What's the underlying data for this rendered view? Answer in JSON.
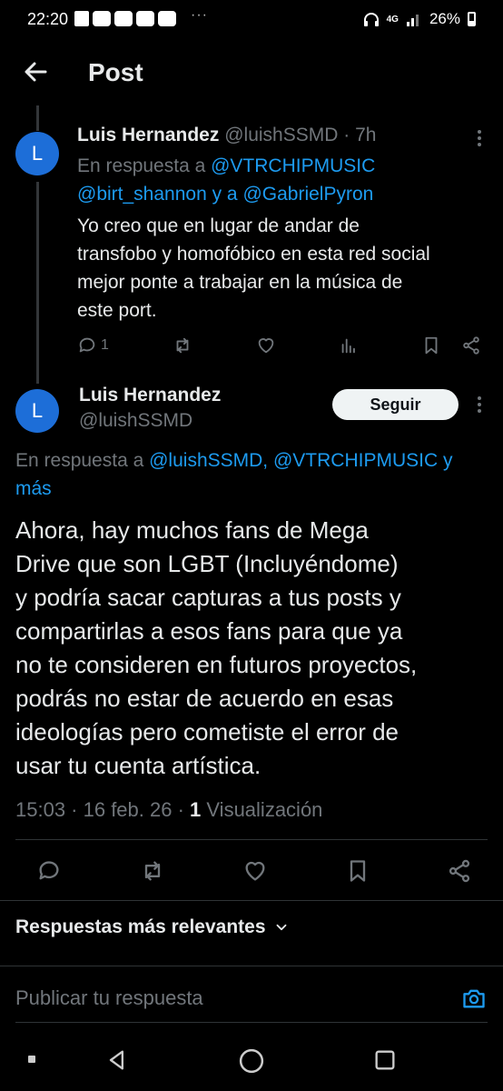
{
  "status_bar": {
    "time": "22:20",
    "dots": "···",
    "network": "4G",
    "battery": "26%"
  },
  "header": {
    "title": "Post"
  },
  "reply_tweet": {
    "avatar_letter": "L",
    "author_name": "Luis Hernandez",
    "handle": "@luishSSMD",
    "separator": "·",
    "time_ago": "7h",
    "in_reply_prefix": "En respuesta a",
    "mention_1": "@VTRCHIPMUSIC",
    "mention_2": "@birt_shannon",
    "and_word": "y a",
    "mention_3": "@GabrielPyron",
    "text_lines": [
      "Yo creo que en lugar de andar de",
      "transfobo y homofóbico en esta red social",
      "mejor ponte a trabajar en la música de",
      "este port."
    ],
    "reply_count": "1"
  },
  "main_tweet": {
    "avatar_letter": "L",
    "author_name": "Luis Hernandez",
    "handle": "@luishSSMD",
    "follow_label": "Seguir",
    "in_reply_prefix": "En respuesta a",
    "mentions": "@luishSSMD, @VTRCHIPMUSIC y",
    "more_link": "más",
    "text_lines": [
      "Ahora, hay muchos fans de Mega",
      "Drive que son LGBT (Incluyéndome)",
      "y podría sacar capturas a tus posts y",
      "compartirlas a esos fans para que ya",
      "no te consideren en futuros proyectos,",
      "podrás no estar de acuerdo en esas",
      "ideologías pero cometiste el error de",
      "usar tu cuenta artística."
    ],
    "timestamp": "15:03 · 16 feb. 26 ·",
    "views_count": "1",
    "views_label": "Visualización"
  },
  "replies_section": {
    "sort_label": "Respuestas más relevantes"
  },
  "compose": {
    "placeholder": "Publicar tu respuesta"
  },
  "colors": {
    "background": "#000000",
    "accent": "#1d9bf0",
    "muted": "#71767b",
    "avatar": "#1d6ed8"
  }
}
